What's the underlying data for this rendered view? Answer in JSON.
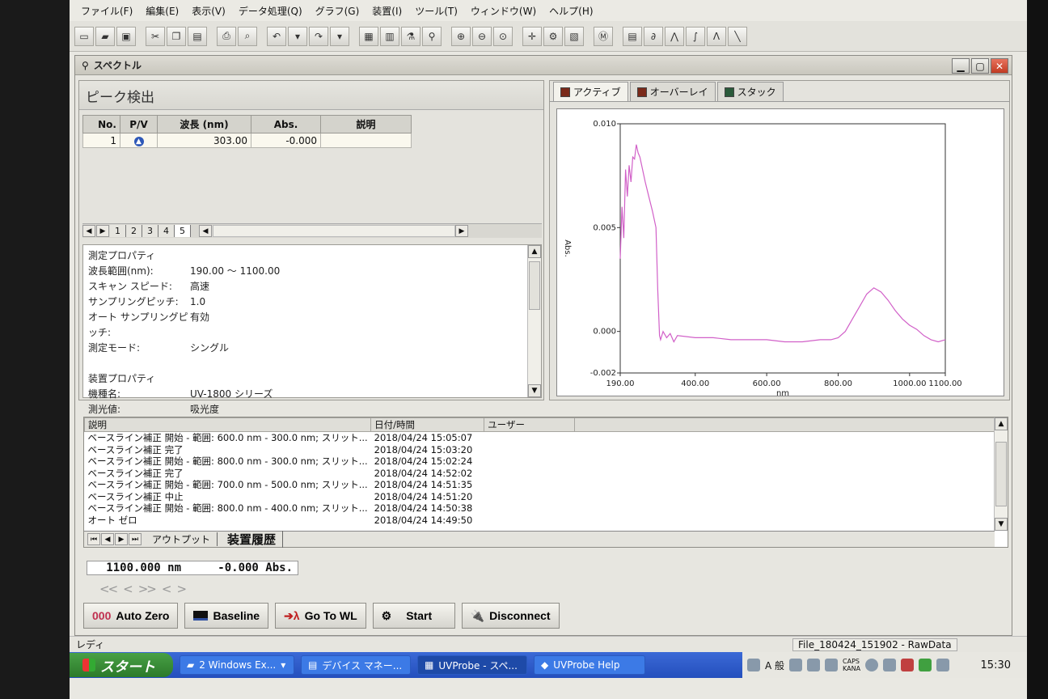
{
  "menu": [
    "ファイル(F)",
    "編集(E)",
    "表示(V)",
    "データ処理(Q)",
    "グラフ(G)",
    "装置(I)",
    "ツール(T)",
    "ウィンドウ(W)",
    "ヘルプ(H)"
  ],
  "child_window": {
    "title": "スペクトル"
  },
  "peak_panel": {
    "title": "ピーク検出",
    "columns": [
      "No.",
      "P/V",
      "波長 (nm)",
      "Abs.",
      "説明"
    ],
    "rows": [
      {
        "no": "1",
        "pv": "peak-icon",
        "wavelength": "303.00",
        "abs": "-0.000",
        "desc": ""
      }
    ],
    "sheet_tabs": [
      "1",
      "2",
      "3",
      "4",
      "5"
    ]
  },
  "measure_props": [
    {
      "label": "測定プロパティ",
      "value": ""
    },
    {
      "label": "波長範囲(nm):",
      "value": "190.00 ～ 1100.00"
    },
    {
      "label": "スキャン スピード:",
      "value": "高速"
    },
    {
      "label": "サンプリングピッチ:",
      "value": "1.0"
    },
    {
      "label": "オート サンプリングピッチ:",
      "value": "有効"
    },
    {
      "label": "測定モード:",
      "value": "シングル"
    },
    {
      "label": "",
      "value": ""
    },
    {
      "label": "装置プロパティ",
      "value": ""
    },
    {
      "label": "機種名:",
      "value": "UV-1800 シリーズ"
    },
    {
      "label": "測光値:",
      "value": "吸光度"
    }
  ],
  "spectrum_tabs": [
    "アクティブ",
    "オーバーレイ",
    "スタック"
  ],
  "chart_data": {
    "type": "line",
    "xlabel": "nm",
    "ylabel": "Abs.",
    "xlim": [
      190,
      1100
    ],
    "ylim": [
      -0.002,
      0.01
    ],
    "x_ticks": [
      "190.00",
      "400.00",
      "600.00",
      "800.00",
      "1000.00",
      "1100.00"
    ],
    "x_tick_values": [
      190,
      400,
      600,
      800,
      1000,
      1100
    ],
    "y_ticks": [
      "0.010",
      "0.005",
      "0.000",
      "-0.002"
    ],
    "y_tick_values": [
      0.01,
      0.005,
      0.0,
      -0.002
    ],
    "grid": false,
    "line_color": "#d160c8",
    "series": [
      {
        "x": [
          190,
          195,
          200,
          205,
          210,
          215,
          220,
          225,
          230,
          235,
          240,
          245,
          250,
          260,
          270,
          280,
          290,
          295,
          300,
          303,
          310,
          320,
          330,
          340,
          350,
          400,
          450,
          500,
          550,
          600,
          650,
          700,
          750,
          780,
          800,
          820,
          840,
          860,
          880,
          900,
          920,
          940,
          960,
          980,
          1000,
          1020,
          1040,
          1060,
          1080,
          1100
        ],
        "y": [
          0.0035,
          0.006,
          0.0045,
          0.0078,
          0.0065,
          0.008,
          0.0072,
          0.0084,
          0.0083,
          0.009,
          0.0086,
          0.0084,
          0.008,
          0.0072,
          0.0065,
          0.0058,
          0.005,
          0.002,
          -0.0002,
          -0.0004,
          0.0,
          -0.0003,
          -0.0001,
          -0.0005,
          -0.0002,
          -0.0003,
          -0.0003,
          -0.0004,
          -0.0004,
          -0.0004,
          -0.0005,
          -0.0005,
          -0.0004,
          -0.0004,
          -0.0003,
          0.0,
          0.0006,
          0.0012,
          0.0018,
          0.0021,
          0.0019,
          0.0015,
          0.001,
          0.0006,
          0.0003,
          0.0001,
          -0.0002,
          -0.0004,
          -0.0005,
          -0.0004
        ]
      }
    ]
  },
  "log": {
    "columns": [
      "説明",
      "日付/時間",
      "ユーザー"
    ],
    "rows": [
      {
        "desc": "ベースライン補正 開始 - 範囲: 600.0 nm - 300.0 nm; スリット...",
        "time": "2018/04/24 15:05:07"
      },
      {
        "desc": "ベースライン補正 完了",
        "time": "2018/04/24 15:03:20"
      },
      {
        "desc": "ベースライン補正 開始 - 範囲: 800.0 nm - 300.0 nm; スリット...",
        "time": "2018/04/24 15:02:24"
      },
      {
        "desc": "ベースライン補正 完了",
        "time": "2018/04/24 14:52:02"
      },
      {
        "desc": "ベースライン補正 開始 - 範囲: 700.0 nm - 500.0 nm; スリット...",
        "time": "2018/04/24 14:51:35"
      },
      {
        "desc": "ベースライン補正 中止",
        "time": "2018/04/24 14:51:20"
      },
      {
        "desc": "ベースライン補正 開始 - 範囲: 800.0 nm - 400.0 nm; スリット...",
        "time": "2018/04/24 14:50:38"
      },
      {
        "desc": "オート ゼロ",
        "time": "2018/04/24 14:49:50"
      }
    ],
    "tabs": [
      "アウトプット",
      "装置履歴"
    ]
  },
  "readout": {
    "wavelength": "1100.000 nm",
    "abs": "-0.000 Abs."
  },
  "controls": {
    "auto_zero": "Auto Zero",
    "baseline": "Baseline",
    "go_to_wl": "Go To WL",
    "start": "Start",
    "disconnect": "Disconnect"
  },
  "status": {
    "left": "レディ",
    "file": "File_180424_151902 - RawData"
  },
  "taskbar": {
    "start": "スタート",
    "tasks": [
      "2 Windows Ex...",
      "デバイス マネー...",
      "UVProbe - スペ...",
      "UVProbe Help"
    ],
    "ime": "A 般",
    "caps": "CAPS",
    "kana": "KANA",
    "clock": "15:30"
  }
}
